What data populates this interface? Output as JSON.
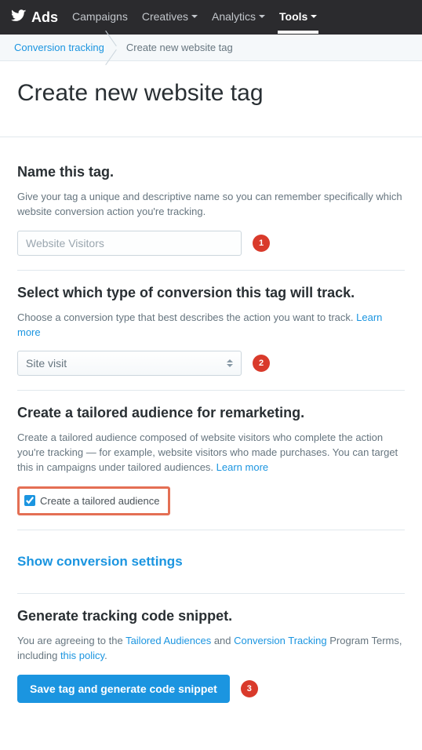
{
  "topnav": {
    "brand": "Ads",
    "items": [
      {
        "label": "Campaigns",
        "hasCaret": false,
        "active": false
      },
      {
        "label": "Creatives",
        "hasCaret": true,
        "active": false
      },
      {
        "label": "Analytics",
        "hasCaret": true,
        "active": false
      },
      {
        "label": "Tools",
        "hasCaret": true,
        "active": true
      }
    ]
  },
  "breadcrumb": {
    "link": "Conversion tracking",
    "current": "Create new website tag"
  },
  "page_title": "Create new website tag",
  "sections": {
    "name": {
      "heading": "Name this tag.",
      "desc": "Give your tag a unique and descriptive name so you can remember specifically which website conversion action you're tracking.",
      "placeholder": "Website Visitors",
      "annot": "1"
    },
    "type": {
      "heading": "Select which type of conversion this tag will track.",
      "desc_text": "Choose a conversion type that best describes the action you want to track. ",
      "learn_more": "Learn more",
      "selected": "Site visit",
      "annot": "2"
    },
    "tailored": {
      "heading": "Create a tailored audience for remarketing.",
      "desc_text": "Create a tailored audience composed of website visitors who complete the action you're tracking — for example, website visitors who made purchases. You can target this in campaigns under tailored audiences. ",
      "learn_more": "Learn more",
      "checkbox_label": "Create a tailored audience",
      "checked": true
    },
    "convset": {
      "label": "Show conversion settings"
    },
    "generate": {
      "heading": "Generate tracking code snippet.",
      "desc_pre": "You are agreeing to the ",
      "link1": "Tailored Audiences",
      "mid": " and ",
      "link2": "Conversion Tracking",
      "desc_post": " Program Terms, including ",
      "link3": "this policy",
      "period": ".",
      "button": "Save tag and generate code snippet",
      "annot": "3"
    }
  }
}
